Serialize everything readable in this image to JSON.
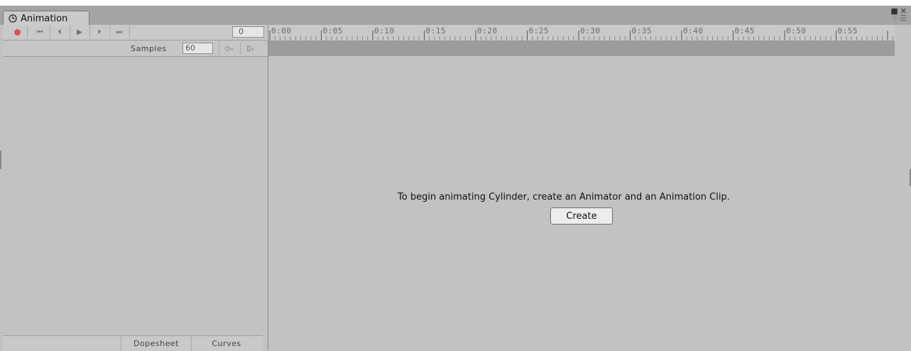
{
  "window": {
    "tab_title": "Animation",
    "icons": {
      "tab": "clock-icon",
      "maximize": "maximize-icon",
      "close": "close-icon",
      "lock": "lock-icon",
      "menu": "menu-icon"
    }
  },
  "toolbar": {
    "buttons": [
      {
        "name": "record-button",
        "icon": "record-icon"
      },
      {
        "name": "first-key-button",
        "icon": "skip-start-icon",
        "glyph": "⏮"
      },
      {
        "name": "previous-key-button",
        "icon": "step-back-icon",
        "glyph": "⏴"
      },
      {
        "name": "play-button",
        "icon": "play-icon",
        "glyph": "▶"
      },
      {
        "name": "next-key-button",
        "icon": "step-forward-icon",
        "glyph": "⏵"
      },
      {
        "name": "last-key-button",
        "icon": "skip-end-icon",
        "glyph": "⏭"
      }
    ],
    "frame_value": "0"
  },
  "samples": {
    "label": "Samples",
    "value": "60",
    "add_keyframe_icon": "add-keyframe-icon",
    "add_event_icon": "add-event-icon"
  },
  "timeline": {
    "tick_labels": [
      "0:00",
      "0:05",
      "0:10",
      "0:15",
      "0:20",
      "0:25",
      "0:30",
      "0:35",
      "0:40",
      "0:45",
      "0:50",
      "0:55"
    ]
  },
  "main": {
    "message": "To begin animating Cylinder, create an Animator and an Animation Clip.",
    "create_label": "Create"
  },
  "bottom_tabs": {
    "dopesheet": "Dopesheet",
    "curves": "Curves"
  }
}
